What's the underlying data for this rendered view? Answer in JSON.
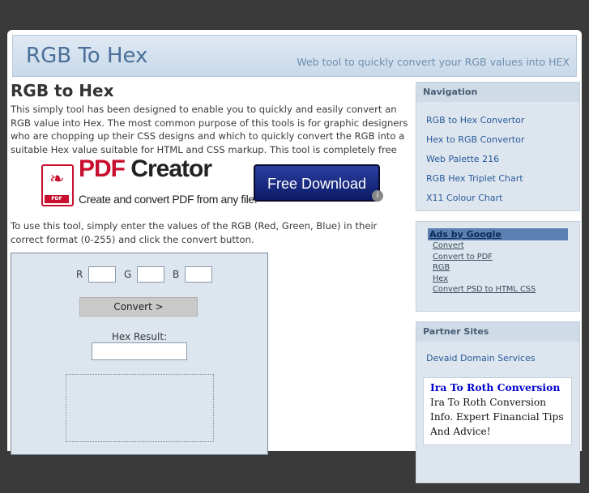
{
  "header": {
    "title": "RGB To Hex",
    "tagline": "Web tool to quickly convert your RGB values into HEX"
  },
  "main": {
    "heading": "RGB to Hex",
    "intro": "This simply tool has been designed to enable you to quickly and easily convert an RGB value into Hex. The most common purpose of this tools is for graphic designers who are chopping up their CSS designs and which to quickly convert the RGB into a suitable Hex value suitable for HTML and CSS markup. This tool is completely free",
    "instructions": "To use this tool, simply enter the values of the RGB (Red, Green, Blue) in their correct format (0-255) and click the convert button."
  },
  "ad": {
    "name_prefix": "PDF",
    "name_suffix": " Creator",
    "subtitle": "Create and convert PDF from any file.",
    "badge": "PDF",
    "button": "Free Download",
    "info": "i"
  },
  "tool": {
    "r_label": "R",
    "g_label": "G",
    "b_label": "B",
    "r_value": "",
    "g_value": "",
    "b_value": "",
    "convert_label": "Convert >",
    "hex_label": "Hex Result:",
    "hex_value": ""
  },
  "sidebar": {
    "nav_title": "Navigation",
    "nav_items": [
      "RGB to Hex Convertor",
      "Hex to RGB Convertor",
      "Web Palette 216",
      "RGB Hex Triplet Chart",
      "X11 Colour Chart"
    ],
    "ads_title": "Ads by Google",
    "ads_links": [
      "Convert",
      "Convert to PDF",
      "RGB",
      "Hex",
      "Convert PSD to HTML CSS"
    ],
    "partner_title": "Partner Sites",
    "partner_link": "Devaid Domain Services",
    "ad_card_title": "Ira To Roth Conversion",
    "ad_card_text": "Ira To Roth Conversion Info. Expert Financial Tips And Advice!"
  },
  "colors": {
    "accent": "#4a6f99",
    "link": "#2a5a99",
    "panel": "#dde6ef"
  }
}
